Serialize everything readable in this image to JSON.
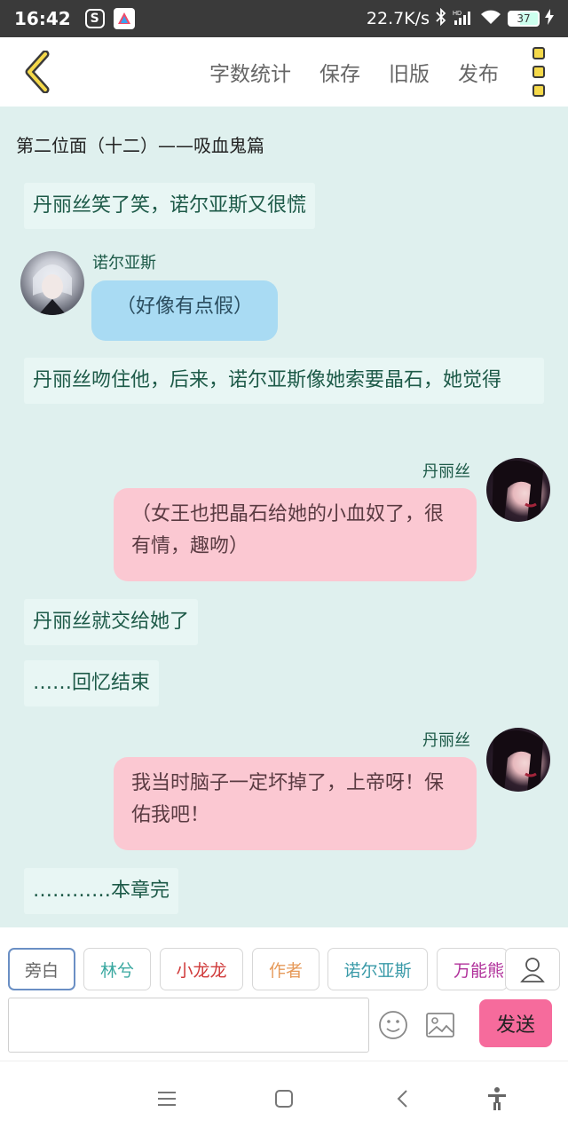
{
  "status_bar": {
    "time": "16:42",
    "app_icon_1": "S",
    "app_icon_2": "A",
    "net_speed": "22.7K/s",
    "battery": "37",
    "icons": [
      "bluetooth-icon",
      "hd-signal-icon",
      "wifi-icon",
      "battery-icon",
      "charging-icon"
    ]
  },
  "toolbar": {
    "back_icon": "chevron-left-icon",
    "word_count": "字数统计",
    "save": "保存",
    "old_version": "旧版",
    "publish": "发布",
    "more_icon": "more-vertical-icon",
    "accent": "#f5d94a"
  },
  "chat": {
    "chapter_title": "第二位面（十二）——吸血鬼篇",
    "messages": [
      {
        "type": "narration",
        "text": "丹丽丝笑了笑，诺尔亚斯又很慌"
      },
      {
        "type": "left",
        "speaker": "诺尔亚斯",
        "text": "（好像有点假）",
        "color": "#a9dbf3"
      },
      {
        "type": "narration",
        "text": "丹丽丝吻住他，后来，诺尔亚斯像她索要晶石，她觉得"
      },
      {
        "type": "right",
        "speaker": "丹丽丝",
        "text": "（女王也把晶石给她的小血奴了，很有情，趣吻）",
        "color": "#fbc8d2"
      },
      {
        "type": "narration",
        "text": "丹丽丝就交给她了"
      },
      {
        "type": "narration",
        "text": "……回忆结束"
      },
      {
        "type": "right",
        "speaker": "丹丽丝",
        "text": "我当时脑子一定坏掉了，上帝呀！保佑我吧！",
        "color": "#fbc8d2"
      },
      {
        "type": "narration",
        "text": "…………本章完"
      }
    ]
  },
  "characters": [
    {
      "label": "旁白",
      "color": "#666666"
    },
    {
      "label": "林兮",
      "color": "#3aa8a0"
    },
    {
      "label": "小龙龙",
      "color": "#d03a3a"
    },
    {
      "label": "作者",
      "color": "#e69a5a"
    },
    {
      "label": "诺尔亚斯",
      "color": "#3a9aa8"
    },
    {
      "label": "万能熊",
      "color": "#b0309a"
    }
  ],
  "composer": {
    "placeholder": "",
    "send": "发送",
    "send_color": "#f66b9c"
  },
  "nav": {
    "icons": [
      "menu-icon",
      "home-icon",
      "back-icon",
      "accessibility-icon"
    ]
  }
}
